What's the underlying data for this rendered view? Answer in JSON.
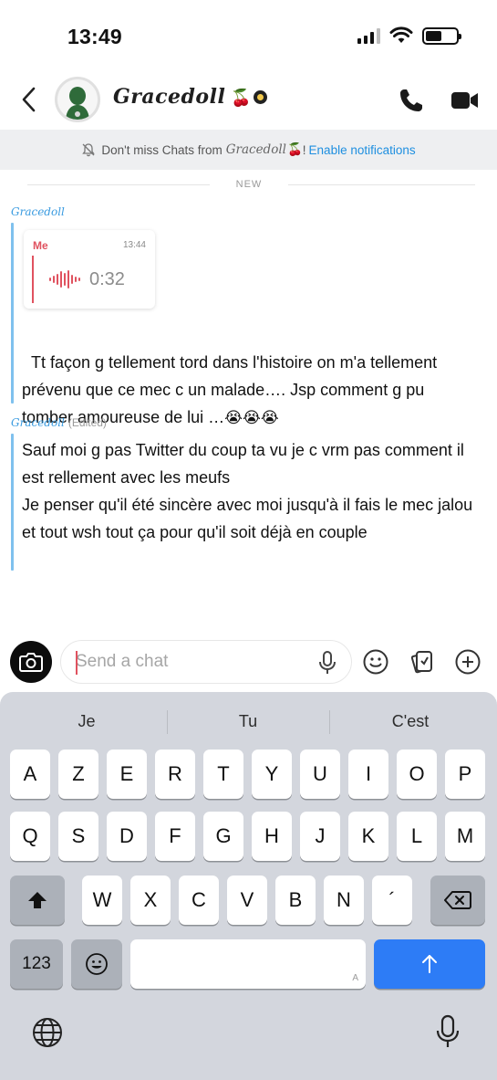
{
  "status_bar": {
    "time": "13:49"
  },
  "header": {
    "contact_name": "Gracedoll",
    "name_emoji": "🍒"
  },
  "notice": {
    "text_prefix": "Don't miss Chats from",
    "name": "Gracedoll",
    "emoji": "🍒",
    "bang": "!",
    "link": "Enable notifications"
  },
  "divider": {
    "label": "NEW"
  },
  "messages": [
    {
      "sender": "Gracedoll",
      "quote": {
        "sender": "Me",
        "time": "13:44",
        "duration": "0:32"
      },
      "text": "Tt façon g tellement tord dans l'histoire on m'a tellement prévenu que ce mec c un malade…. Jsp comment g pu tomber amoureuse de lui …",
      "emoji": "😭😭😭"
    },
    {
      "sender": "Gracedoll",
      "edited": "(Edited)",
      "text": "Sauf moi g pas Twitter du coup ta vu je c vrm pas comment il est rellement avec les meufs\nJe penser qu'il été sincère avec moi jusqu'à il fais le mec jalou et tout wsh tout ça pour qu'il soit déjà en couple"
    }
  ],
  "composer": {
    "placeholder": "Send a chat",
    "value": ""
  },
  "keyboard": {
    "suggestions": [
      "Je",
      "Tu",
      "C'est"
    ],
    "row1": [
      "A",
      "Z",
      "E",
      "R",
      "T",
      "Y",
      "U",
      "I",
      "O",
      "P"
    ],
    "row2": [
      "Q",
      "S",
      "D",
      "F",
      "G",
      "H",
      "J",
      "K",
      "L",
      "M"
    ],
    "row3": [
      "W",
      "X",
      "C",
      "V",
      "B",
      "N",
      "´"
    ],
    "numbers_key": "123",
    "space_corner": "A"
  },
  "icons": {
    "back": "chevron-left-icon",
    "call": "phone-icon",
    "video": "video-camera-icon",
    "bell_off": "bell-off-icon",
    "camera": "camera-icon",
    "mic": "microphone-icon",
    "sticker": "smiley-icon",
    "cards": "cards-icon",
    "plus": "plus-circle-icon",
    "shift": "shift-icon",
    "backspace": "backspace-icon",
    "emoji_key": "emoji-icon",
    "return": "arrow-up-icon",
    "globe": "globe-icon"
  },
  "colors": {
    "accent_blue": "#1e8fe0",
    "sender_blue": "#3a9be0",
    "me_red": "#e0525f",
    "keyboard_bg": "#d3d6dd",
    "return_key": "#2d7cf6"
  }
}
